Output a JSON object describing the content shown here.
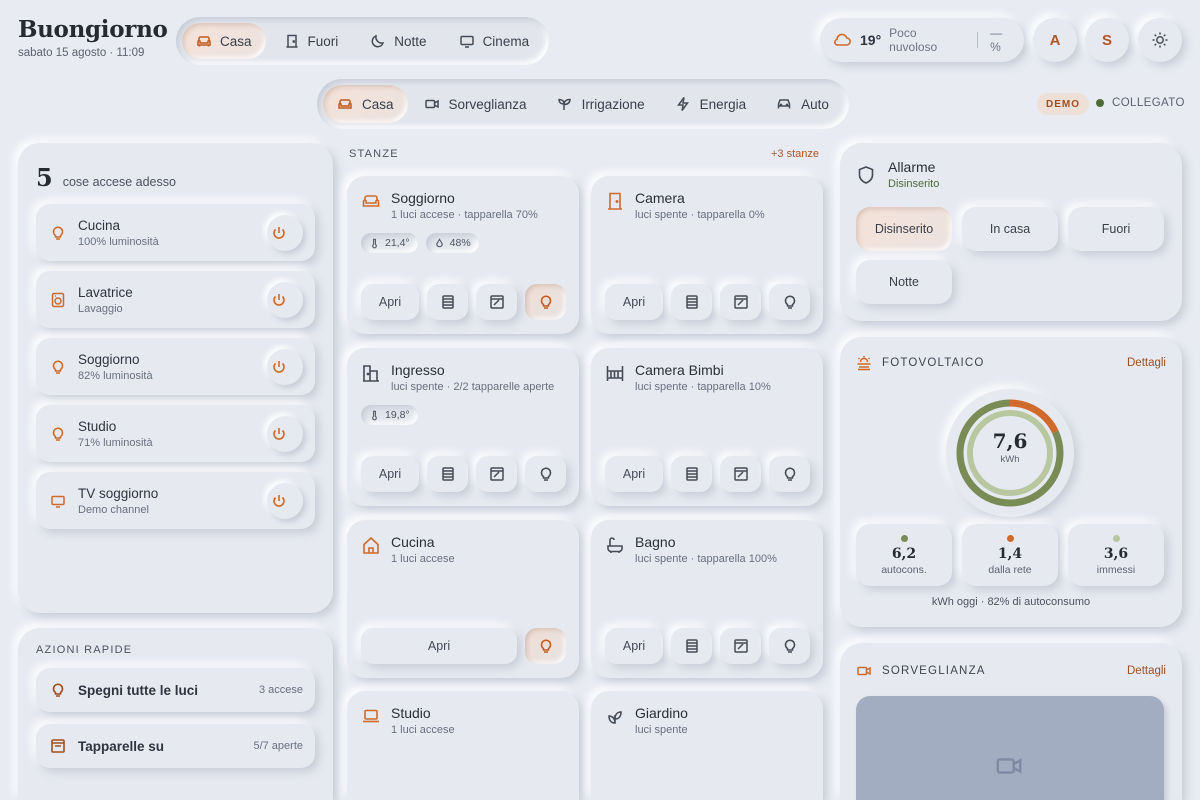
{
  "header": {
    "greeting": "Buongiorno",
    "datetime": "sabato 15 agosto · 11:09"
  },
  "modes": [
    {
      "label": "Casa",
      "active": true,
      "icon": "sofa-icon"
    },
    {
      "label": "Fuori",
      "active": false,
      "icon": "door-icon"
    },
    {
      "label": "Notte",
      "active": false,
      "icon": "moon-icon"
    },
    {
      "label": "Cinema",
      "active": false,
      "icon": "tv-icon"
    }
  ],
  "weather": {
    "temp": "19°",
    "condition": "Poco nuvoloso",
    "humidity": "—%",
    "icon": "cloud-icon"
  },
  "users": [
    "A",
    "S"
  ],
  "nav": [
    {
      "label": "Casa",
      "active": true,
      "icon": "sofa-icon"
    },
    {
      "label": "Sorveglianza",
      "active": false,
      "icon": "camera-icon"
    },
    {
      "label": "Irrigazione",
      "active": false,
      "icon": "sprout-icon"
    },
    {
      "label": "Energia",
      "active": false,
      "icon": "bolt-icon"
    },
    {
      "label": "Auto",
      "active": false,
      "icon": "car-icon"
    }
  ],
  "status": {
    "badge": "DEMO",
    "connection": "COLLEGATO",
    "connection_color": "#4f6b3a"
  },
  "active_devices": {
    "count": "5",
    "label": "cose accese adesso",
    "items": [
      {
        "name": "Cucina",
        "detail": "100% luminosità",
        "icon": "bulb-icon"
      },
      {
        "name": "Lavatrice",
        "detail": "Lavaggio",
        "icon": "washer-icon"
      },
      {
        "name": "Soggiorno",
        "detail": "82% luminosità",
        "icon": "bulb-icon"
      },
      {
        "name": "Studio",
        "detail": "71% luminosità",
        "icon": "bulb-icon"
      },
      {
        "name": "TV soggiorno",
        "detail": "Demo channel",
        "icon": "tv-icon"
      }
    ]
  },
  "quick_actions": {
    "title": "AZIONI RAPIDE",
    "items": [
      {
        "label": "Spegni tutte le luci",
        "count": "3 accese",
        "icon": "bulb-icon"
      },
      {
        "label": "Tapparelle su",
        "count": "5/7 aperte",
        "icon": "blinds-icon"
      }
    ]
  },
  "rooms": {
    "title": "STANZE",
    "more": "+3 stanze",
    "open_label": "Apri",
    "items": [
      {
        "name": "Soggiorno",
        "detail": "1 luci accese · tapparella 70%",
        "icon": "sofa-icon",
        "chips": [
          {
            "icon": "thermometer-icon",
            "value": "21,4°"
          },
          {
            "icon": "drop-icon",
            "value": "48%"
          }
        ],
        "controls": "full",
        "light_on": true
      },
      {
        "name": "Camera",
        "detail": "luci spente · tapparella 0%",
        "icon": "door-icon",
        "chips": [],
        "controls": "full",
        "light_on": false
      },
      {
        "name": "Ingresso",
        "detail": "luci spente · 2/2 tapparelle aperte",
        "icon": "entrance-icon",
        "chips": [
          {
            "icon": "thermometer-icon",
            "value": "19,8°"
          }
        ],
        "controls": "full",
        "light_on": false
      },
      {
        "name": "Camera Bimbi",
        "detail": "luci spente · tapparella 10%",
        "icon": "crib-icon",
        "chips": [],
        "controls": "full",
        "light_on": false
      },
      {
        "name": "Cucina",
        "detail": "1 luci accese",
        "icon": "house-icon",
        "chips": [],
        "controls": "light",
        "light_on": true
      },
      {
        "name": "Bagno",
        "detail": "luci spente · tapparella 100%",
        "icon": "bathtub-icon",
        "chips": [],
        "controls": "full",
        "light_on": false
      },
      {
        "name": "Studio",
        "detail": "1 luci accese",
        "icon": "laptop-icon",
        "chips": [],
        "controls": "none",
        "light_on": true
      },
      {
        "name": "Giardino",
        "detail": "luci spente",
        "icon": "leaf-icon",
        "chips": [],
        "controls": "none",
        "light_on": false
      }
    ]
  },
  "alarm": {
    "title": "Allarme",
    "state": "Disinserito",
    "options": [
      {
        "label": "Disinserito",
        "active": true
      },
      {
        "label": "In casa",
        "active": false
      },
      {
        "label": "Fuori",
        "active": false
      },
      {
        "label": "Notte",
        "active": false
      }
    ]
  },
  "solar": {
    "title": "FOTOVOLTAICO",
    "details": "Dettagli",
    "value": "7,6",
    "unit": "kWh",
    "self_share": 0.82,
    "stats": [
      {
        "value": "6,2",
        "label": "autocons.",
        "color": "#7a8c55"
      },
      {
        "value": "1,4",
        "label": "dalla rete",
        "color": "#d06a2a"
      },
      {
        "value": "3,6",
        "label": "immessi",
        "color": "#b9c7a0"
      }
    ],
    "footer": "kWh oggi · 82% di autoconsumo",
    "colors": {
      "self": "#7a8c55",
      "grid": "#d06a2a",
      "export": "#b9c7a0"
    }
  },
  "surveillance": {
    "title": "SORVEGLIANZA",
    "details": "Dettagli"
  }
}
